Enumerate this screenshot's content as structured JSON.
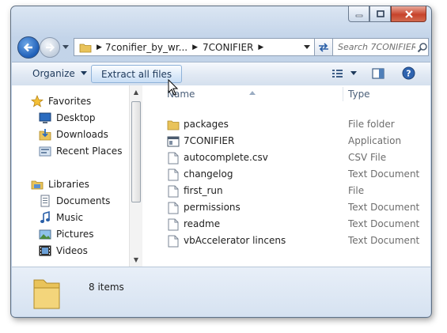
{
  "window": {
    "title_buttons": {
      "minimize_icon": "minimize-icon",
      "maximize_icon": "maximize-icon",
      "close_icon": "close-icon"
    }
  },
  "address_bar": {
    "segments": [
      "7conifier_by_wr...",
      "7CONIFIER"
    ],
    "search_placeholder": "Search 7CONIFIER"
  },
  "toolbar": {
    "organize_label": "Organize",
    "extract_label": "Extract all files"
  },
  "nav_pane": {
    "favorites_label": "Favorites",
    "favorites": [
      {
        "label": "Desktop",
        "icon": "desktop-icon"
      },
      {
        "label": "Downloads",
        "icon": "downloads-icon"
      },
      {
        "label": "Recent Places",
        "icon": "recent-places-icon"
      }
    ],
    "libraries_label": "Libraries",
    "libraries": [
      {
        "label": "Documents",
        "icon": "documents-icon"
      },
      {
        "label": "Music",
        "icon": "music-icon"
      },
      {
        "label": "Pictures",
        "icon": "pictures-icon"
      },
      {
        "label": "Videos",
        "icon": "videos-icon"
      }
    ]
  },
  "file_list": {
    "columns": {
      "name": "Name",
      "type": "Type"
    },
    "rows": [
      {
        "name": "packages",
        "type": "File folder",
        "icon": "folder-icon"
      },
      {
        "name": "7CONIFIER",
        "type": "Application",
        "icon": "application-icon"
      },
      {
        "name": "autocomplete.csv",
        "type": "CSV File",
        "icon": "csv-file-icon"
      },
      {
        "name": "changelog",
        "type": "Text Document",
        "icon": "text-document-icon"
      },
      {
        "name": "first_run",
        "type": "File",
        "icon": "file-icon"
      },
      {
        "name": "permissions",
        "type": "Text Document",
        "icon": "text-document-icon"
      },
      {
        "name": "readme",
        "type": "Text Document",
        "icon": "text-document-icon"
      },
      {
        "name": "vbAccelerator lincens",
        "type": "Text Document",
        "icon": "text-document-icon"
      }
    ]
  },
  "details_pane": {
    "item_count": "8 items"
  },
  "colors": {
    "chrome": "#c3d4e9",
    "accent": "#1f5fb8",
    "close_button": "#c7432b",
    "folder": "#e9c35a"
  }
}
